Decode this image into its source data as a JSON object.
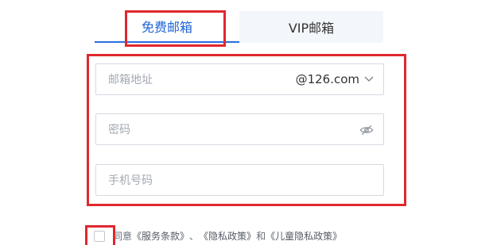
{
  "tabs": {
    "free": "免费邮箱",
    "vip": "VIP邮箱"
  },
  "form": {
    "email_placeholder": "邮箱地址",
    "domain": "@126.com",
    "password_placeholder": "密码",
    "phone_placeholder": "手机号码"
  },
  "agreement": {
    "prefix": "同意",
    "terms": "《服务条款》",
    "sep1": "、",
    "privacy": "《隐私政策》",
    "and": "和",
    "child_privacy": "《儿童隐私政策》"
  },
  "icons": {
    "domain_dropdown": "chevron-down-icon",
    "password_visibility": "eye-off-icon"
  },
  "colors": {
    "accent": "#2a6ce0",
    "highlight": "#e0282e",
    "vip_tab_bg": "#f3f6fa"
  }
}
